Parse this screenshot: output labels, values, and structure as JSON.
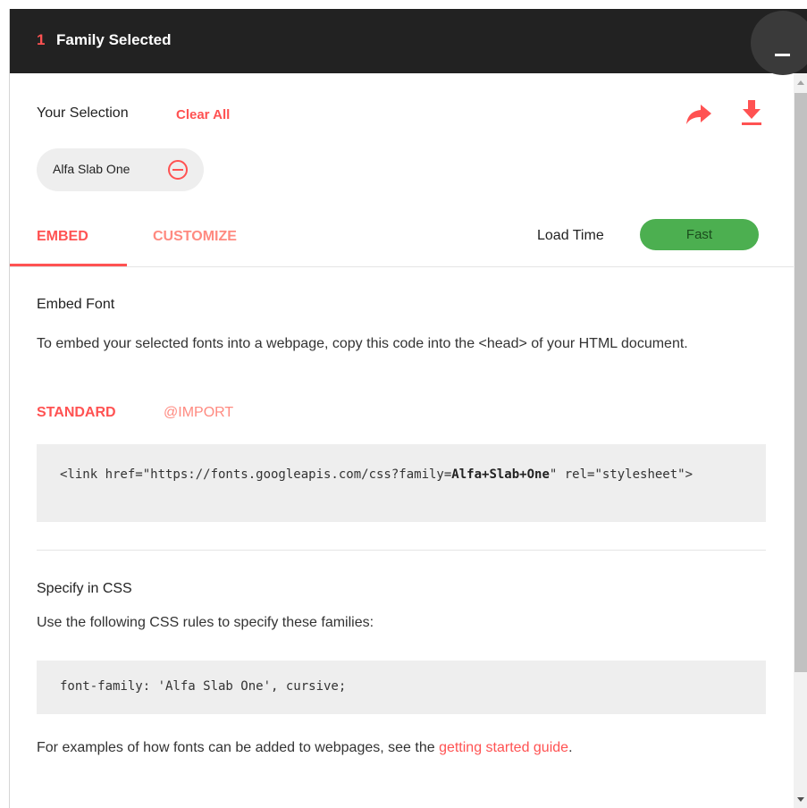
{
  "header": {
    "count": "1",
    "title": "Family Selected",
    "minimize_label": "_"
  },
  "selection": {
    "label": "Your Selection",
    "clear_all": "Clear All",
    "chips": [
      {
        "label": "Alfa Slab One"
      }
    ]
  },
  "tabs": [
    {
      "label": "EMBED",
      "active": true
    },
    {
      "label": "CUSTOMIZE",
      "active": false
    }
  ],
  "load_time": {
    "label": "Load Time",
    "value": "Fast",
    "color": "#4caf50"
  },
  "embed": {
    "heading": "Embed Font",
    "description": "To embed your selected fonts into a webpage, copy this code into the <head> of your HTML document.",
    "sub_tabs": [
      {
        "label": "STANDARD",
        "active": true
      },
      {
        "label": "@IMPORT",
        "active": false
      }
    ],
    "code_prefix": "<link href=\"https://fonts.googleapis.com/css?family=",
    "code_family": "Alfa+Slab+One",
    "code_suffix": "\" rel=\"stylesheet\">"
  },
  "css": {
    "heading": "Specify in CSS",
    "description": "Use the following CSS rules to specify these families:",
    "code": "font-family: 'Alfa Slab One', cursive;"
  },
  "footer": {
    "text": "For examples of how fonts can be added to webpages, see the ",
    "link": "getting started guide",
    "period": "."
  },
  "colors": {
    "accent": "#ff5252",
    "accent_light": "#ff8a80",
    "header_bg": "#222222",
    "fast_green": "#4caf50"
  },
  "icons": [
    "share-icon",
    "download-icon",
    "remove-circle-icon",
    "minimize-icon"
  ]
}
